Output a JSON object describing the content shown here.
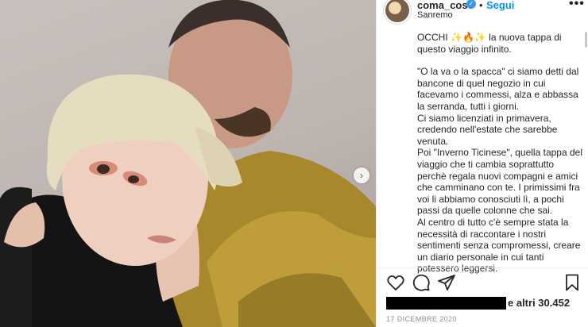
{
  "post": {
    "username": "coma_cose",
    "verified_icon": "✓",
    "separator": "•",
    "follow_label": "Segui",
    "more_icon": "•••",
    "location": "Sanremo",
    "next_icon": "›"
  },
  "caption": {
    "lines": [
      "OCCHI ✨🔥✨ la nuova tappa di questo viaggio infinito.",
      "",
      "\"O la va o la spacca\" ci siamo detti dal bancone di quel negozio in cui facevamo i commessi, alza e abbassa la serranda, tutti i giorni.",
      "Ci siamo licenziati in primavera, credendo nell'estate che sarebbe venuta.",
      "Poi \"Inverno Ticinese\", quella tappa del viaggio che ti cambia soprattutto perchè regala nuovi compagni e amici che camminano con te. I primissimi fra voi li abbiamo conosciuti lì, a pochi passi da quelle colonne che sai.",
      "Al centro di tutto c'è sempre stata la necessità di raccontare i nostri sentimenti senza compromessi, creare un diario personale in cui tanti potessero leggersi."
    ]
  },
  "likes": {
    "text": "e altri 30.452"
  },
  "date": "17 DICEMBRE 2020",
  "icons": {
    "like": "heart-icon",
    "comment": "comment-icon",
    "share": "share-icon",
    "save": "bookmark-icon"
  }
}
